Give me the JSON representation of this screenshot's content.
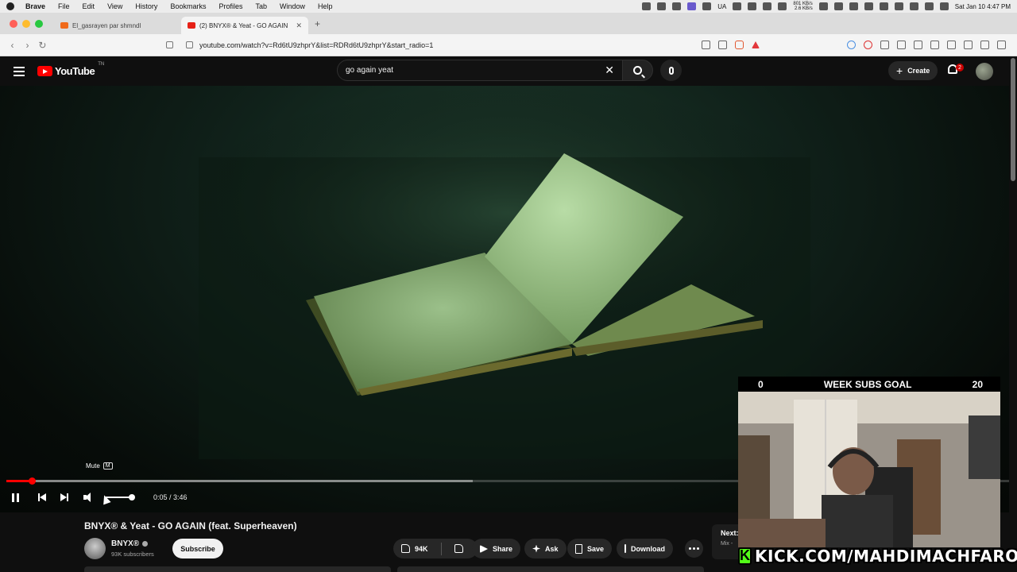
{
  "menubar": {
    "app": "Brave",
    "items": [
      "File",
      "Edit",
      "View",
      "History",
      "Bookmarks",
      "Profiles",
      "Tab",
      "Window",
      "Help"
    ],
    "net_up": "801 KB/s",
    "net_down": "2.6 KB/s",
    "lang": "UA",
    "datetime": "Sat Jan 10  4:47 PM"
  },
  "tabs": [
    {
      "title": "El_gasrayen par shmndl",
      "active": false
    },
    {
      "title": "(2) BNYX® & Yeat - GO AGAIN",
      "active": true
    }
  ],
  "address": {
    "url": "youtube.com/watch?v=Rd6tU9zhprY&list=RDRd6tU9zhprY&start_radio=1"
  },
  "yt_header": {
    "logo_text": "YouTube",
    "logo_sup": "TN",
    "search_value": "go again yeat",
    "create_label": "Create",
    "notif_count": "2"
  },
  "player": {
    "tooltip_label": "Mute",
    "tooltip_key": "M",
    "current_time": "0:05",
    "duration": "3:46",
    "time_display": "0:05 / 3:46",
    "progress_fraction": 0.025,
    "buffered_fraction": 0.465,
    "volume_fraction": 1.0
  },
  "video": {
    "title": "BNYX® & Yeat - GO AGAIN (feat. Superheaven)",
    "channel": "BNYX®",
    "subscribers": "93K subscribers",
    "subscribe_label": "Subscribe",
    "likes": "94K",
    "share_label": "Share",
    "ask_label": "Ask",
    "save_label": "Save",
    "download_label": "Download"
  },
  "up_next": {
    "label": "Next:",
    "sub": "Mix -"
  },
  "overlay": {
    "goal_current": "0",
    "goal_label": "WEEK SUBS GOAL",
    "goal_target": "20",
    "kick_logo": "K",
    "kick_text": "KICK.COM/MAHDIMACHFAROTB"
  },
  "colors": {
    "yt_red": "#ff0000",
    "kick_green": "#53fc18",
    "bg": "#0f0f0f"
  }
}
